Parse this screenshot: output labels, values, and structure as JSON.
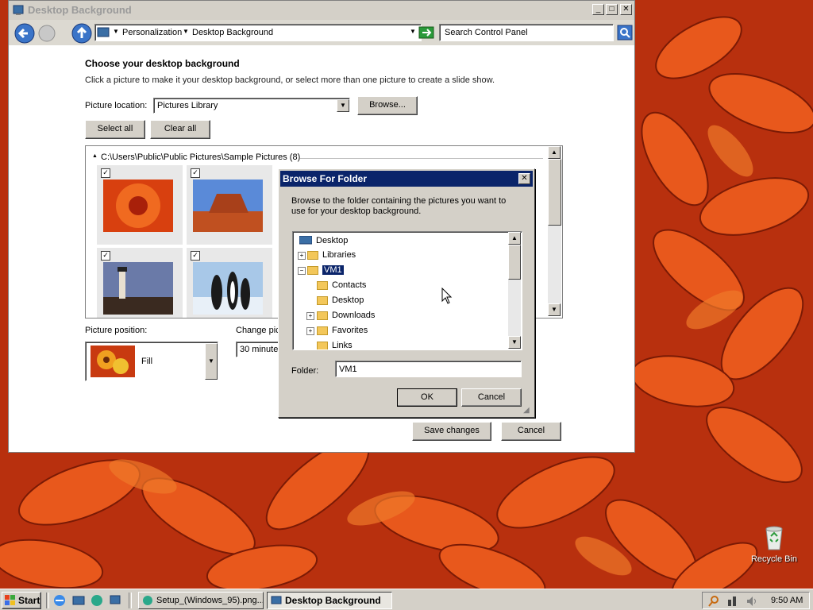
{
  "window": {
    "title": "Desktop Background",
    "breadcrumb": [
      "Personalization",
      "Desktop Background"
    ],
    "search_placeholder": "Search Control Panel"
  },
  "main": {
    "heading": "Choose your desktop background",
    "subheading": "Click a picture to make it your desktop background, or select more than one picture to create a slide show.",
    "picture_location_label": "Picture location:",
    "picture_location_value": "Pictures Library",
    "browse_label": "Browse...",
    "select_all_label": "Select all",
    "clear_all_label": "Clear all",
    "group_header": "C:\\Users\\Public\\Public Pictures\\Sample Pictures (8)",
    "picture_position_label": "Picture position:",
    "picture_position_value": "Fill",
    "change_picture_label": "Change pic",
    "interval_value": "30 minutes",
    "save_label": "Save changes",
    "cancel_label": "Cancel"
  },
  "dialog": {
    "title": "Browse For Folder",
    "description": "Browse to the folder containing the pictures you want to use for your desktop background.",
    "tree": [
      {
        "label": "Desktop"
      },
      {
        "label": "Libraries"
      },
      {
        "label": "VM1"
      },
      {
        "label": "Contacts"
      },
      {
        "label": "Desktop"
      },
      {
        "label": "Downloads"
      },
      {
        "label": "Favorites"
      },
      {
        "label": "Links"
      }
    ],
    "folder_label": "Folder:",
    "folder_value": "VM1",
    "ok_label": "OK",
    "cancel_label": "Cancel"
  },
  "desktop": {
    "recycle_bin_label": "Recycle Bin"
  },
  "taskbar": {
    "start_label": "Start",
    "tasks": [
      "Setup_(Windows_95).png...",
      "Desktop Background"
    ],
    "clock": "9:50 AM"
  }
}
